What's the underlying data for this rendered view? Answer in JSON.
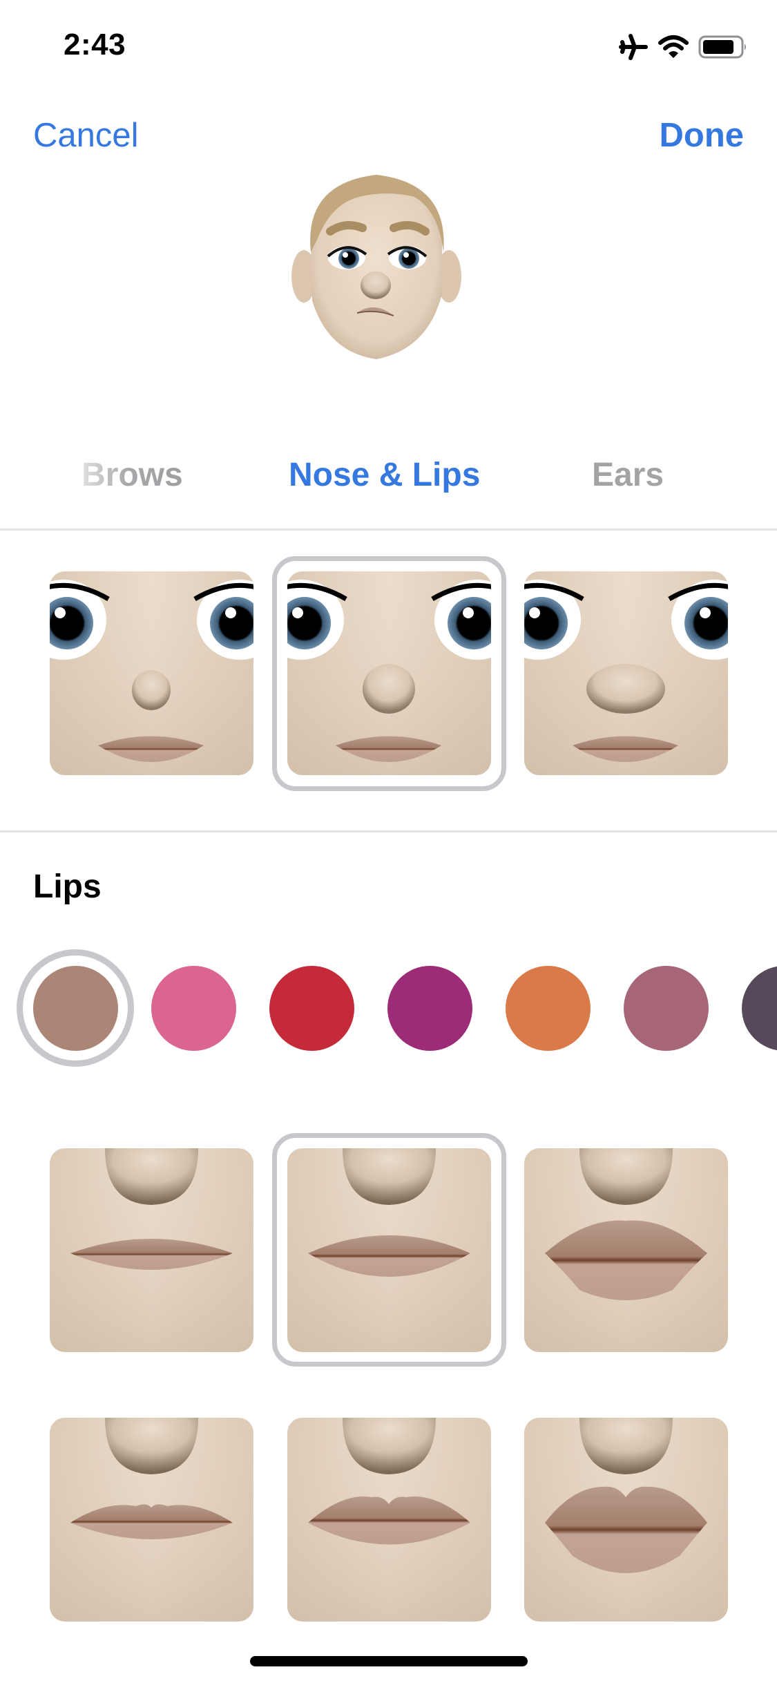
{
  "status_bar": {
    "time": "2:43",
    "icons": [
      "airplane-mode-icon",
      "wifi-icon",
      "battery-icon"
    ]
  },
  "nav": {
    "cancel_label": "Cancel",
    "done_label": "Done",
    "accent_color": "#3478e0"
  },
  "avatar": {
    "description": "Memoji preview head"
  },
  "tabs": [
    {
      "label": "Brows",
      "selected": false
    },
    {
      "label": "Nose & Lips",
      "selected": true
    },
    {
      "label": "Ears",
      "selected": false
    }
  ],
  "nose_options": {
    "selected_index": 1,
    "items": [
      {
        "name": "nose-small"
      },
      {
        "name": "nose-medium"
      },
      {
        "name": "nose-wide"
      }
    ]
  },
  "lips": {
    "section_title": "Lips",
    "colors": {
      "selected_index": 0,
      "items": [
        "#ab8576",
        "#dc6490",
        "#c42a3a",
        "#9d2c78",
        "#d97a48",
        "#a76677",
        "#564a5a"
      ]
    },
    "shapes": {
      "selected_index": 1,
      "items": [
        {
          "name": "lips-thin"
        },
        {
          "name": "lips-medium"
        },
        {
          "name": "lips-full"
        },
        {
          "name": "lips-thin-bow"
        },
        {
          "name": "lips-medium-bow"
        },
        {
          "name": "lips-full-bow"
        }
      ]
    }
  }
}
